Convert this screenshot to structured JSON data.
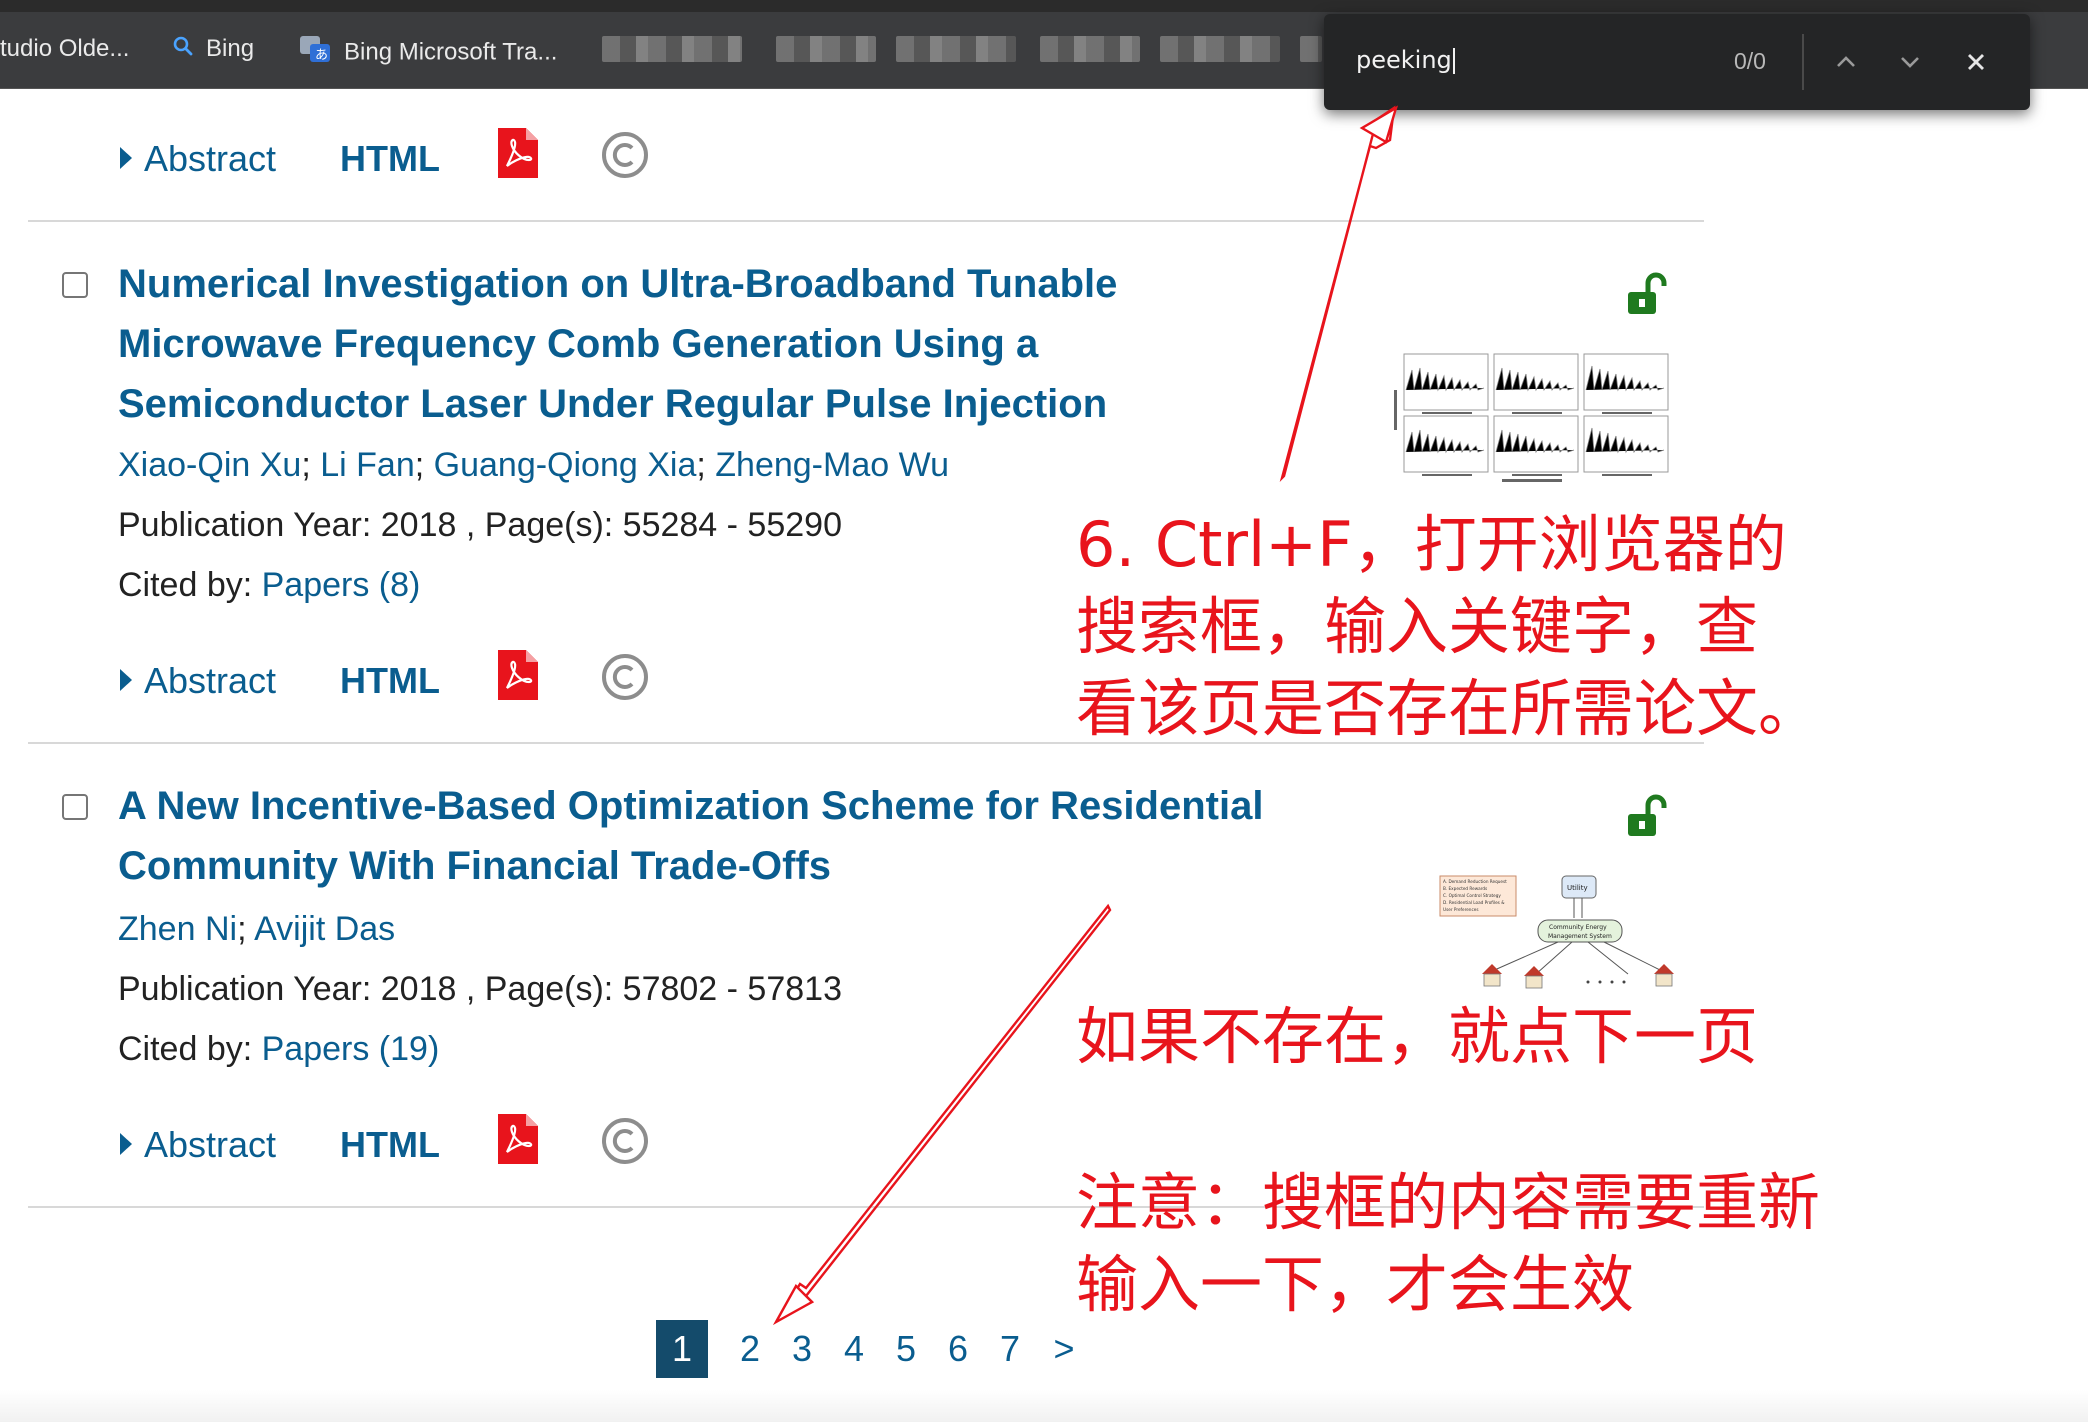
{
  "browser": {
    "bookmarks": [
      {
        "label": "tudio Olde...",
        "icon": "none"
      },
      {
        "label": "Bing",
        "icon": "search-icon"
      },
      {
        "label": "Bing Microsoft Tra...",
        "icon": "translator-icon"
      }
    ],
    "find_bar": {
      "query": "peeking",
      "count": "0/0",
      "prev_icon": "chevron-up-icon",
      "next_icon": "chevron-down-icon",
      "close_icon": "close-icon"
    }
  },
  "actions": {
    "abstract_label": "Abstract",
    "html_label": "HTML",
    "pdf_icon": "pdf-icon",
    "copyright_icon": "copyright-icon"
  },
  "results": [
    {
      "title_lines": [
        "Numerical Investigation on Ultra-Broadband Tunable",
        "Microwave Frequency Comb Generation Using a",
        "Semiconductor Laser Under Regular Pulse Injection"
      ],
      "authors": [
        "Xiao-Qin Xu",
        "Li Fan",
        "Guang-Qiong Xia",
        "Zheng-Mao Wu"
      ],
      "pub_prefix": "Publication Year: 2018 , Page(s): 55284  -  55290",
      "cited_prefix": "Cited by: ",
      "cited_link": "Papers (8)",
      "access_icon": "open-lock-icon"
    },
    {
      "title_lines": [
        "A New Incentive-Based Optimization Scheme for Residential",
        "Community With Financial Trade-Offs"
      ],
      "authors": [
        "Zhen Ni",
        "Avijit Das"
      ],
      "pub_prefix": "Publication Year: 2018 , Page(s): 57802  -  57813",
      "cited_prefix": "Cited by: ",
      "cited_link": "Papers (19)",
      "access_icon": "open-lock-icon",
      "thumb": {
        "box1_lines": [
          "A. Demand Reduction Request",
          "B. Expected Rewards",
          "C. Optimal Control Strategy",
          "D. Residential Load Profiles &",
          "User Preferences"
        ],
        "utility": "Utility",
        "cems_lines": [
          "Community Energy",
          "Management System"
        ]
      }
    }
  ],
  "pagination": {
    "pages": [
      "1",
      "2",
      "3",
      "4",
      "5",
      "6",
      "7"
    ],
    "active": "1",
    "next": ">"
  },
  "annotations": {
    "step6_lines": [
      "6. Ctrl+F，打开浏览器的",
      "搜索框，输入关键字，查",
      "看该页是否存在所需论文。"
    ],
    "next_page": "如果不存在，就点下一页",
    "note_lines": [
      "注意：搜框的内容需要重新",
      "输入一下，才会生效"
    ],
    "color": "#e8141c"
  }
}
